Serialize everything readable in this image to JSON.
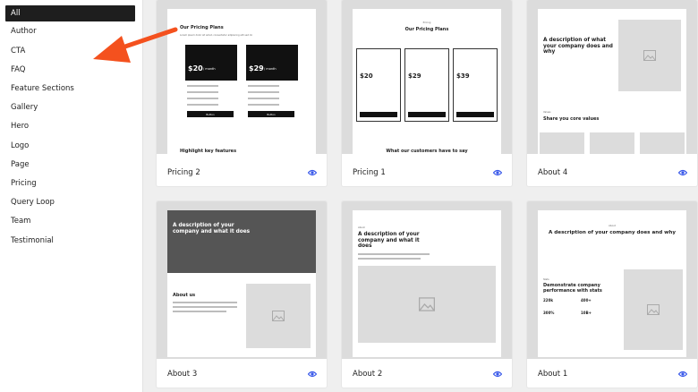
{
  "sidebar": {
    "items": [
      "All",
      "Author",
      "CTA",
      "FAQ",
      "Feature Sections",
      "Gallery",
      "Hero",
      "Logo",
      "Page",
      "Pricing",
      "Query Loop",
      "Team",
      "Testimonial"
    ],
    "active": "All"
  },
  "cards": [
    {
      "title": "Pricing 2"
    },
    {
      "title": "Pricing 1"
    },
    {
      "title": "About 4"
    },
    {
      "title": "About 3"
    },
    {
      "title": "About 2"
    },
    {
      "title": "About 1"
    }
  ],
  "previews": {
    "pricing2": {
      "heading": "Our Pricing Plans",
      "plan_a_price": "$20",
      "plan_b_price": "$29",
      "per": "/ month",
      "button": "Button",
      "bottom_heading": "Highlight key features"
    },
    "pricing1": {
      "eyebrow": "Pricing",
      "heading": "Our Pricing Plans",
      "prices": [
        "$20",
        "$29",
        "$39"
      ],
      "per": "/ month",
      "button": "Button",
      "bottom_heading": "What our customers have to say"
    },
    "about4": {
      "heading": "A description of what your company does and why",
      "eyebrow": "Values",
      "values_heading": "Share you core values"
    },
    "about3": {
      "hero_heading": "A description of your company and what it does",
      "about_heading": "About us"
    },
    "about2": {
      "eyebrow": "About",
      "heading": "A description of your company and what it does"
    },
    "about1": {
      "eyebrow": "About",
      "heading": "A description of your company does and why",
      "stats_eyebrow": "Stats",
      "stats_heading": "Demonstrate company performance with stats",
      "stats": [
        "220k",
        "400+",
        "300%",
        "10B+"
      ]
    }
  },
  "colors": {
    "accent": "#3858e9",
    "arrow": "#f4511e",
    "active_bg": "#1e1e1e"
  },
  "icons": {
    "preview_action": "eye-icon",
    "image_placeholder": "image-icon"
  }
}
